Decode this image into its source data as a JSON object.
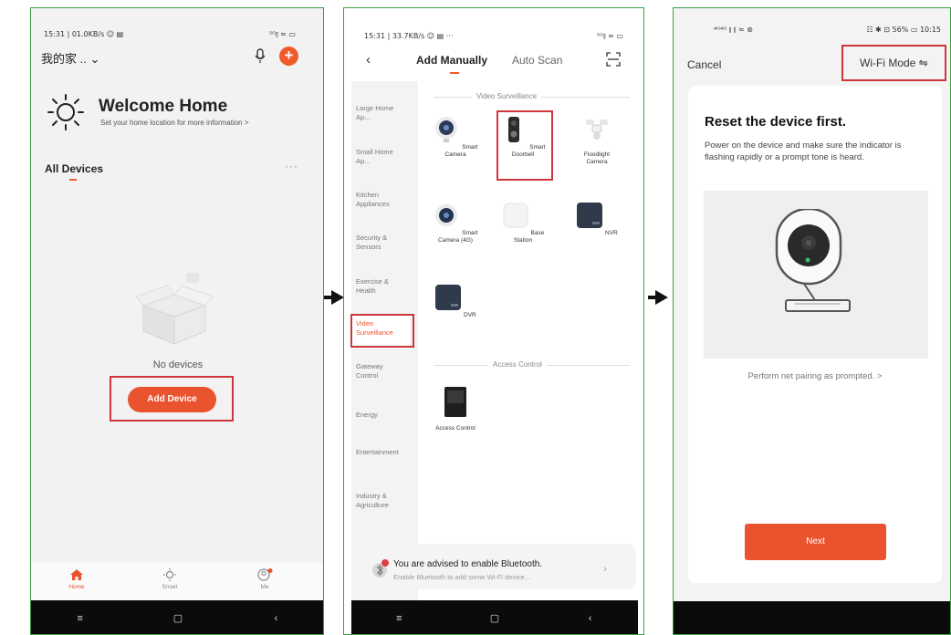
{
  "panel1": {
    "status_left": "15:31 | 01.0KB/s ☺ ▤",
    "status_right": "⁵ᴳ⫾ ≈ ▭",
    "home_title": "我的家 .. ⌄",
    "welcome_title": "Welcome Home",
    "welcome_sub": "Set your home location for more information >",
    "all_devices": "All Devices",
    "more": "···",
    "no_devices": "No devices",
    "add_device": "Add Device",
    "tabs": [
      "Home",
      "Smart",
      "Me"
    ],
    "nav": [
      "≡",
      "▢",
      "‹"
    ],
    "accent_color": "#e9542e"
  },
  "panel2": {
    "status_left": "15:31 | 33.7KB/s ☺ ▤ ···",
    "status_right": "⁵ᴳ⫾ ≈ ▭",
    "back": "‹",
    "tab_manual": "Add Manually",
    "tab_auto": "Auto Scan",
    "categories": [
      "Large Home Ap...",
      "Small Home Ap...",
      "Kitchen Appliances",
      "Security & Sensors",
      "Exercise & Health",
      "Video Surveillance",
      "Gateway Control",
      "Energy",
      "Entertainment",
      "Industry & Agriculture"
    ],
    "section_video": "Video Surveillance",
    "section_access": "Access Control",
    "items": [
      "Smart Camera",
      "Smart Doorbell",
      "Floodlight Camera",
      "Smart Camera (4G)",
      "Base Station",
      "NVR",
      "DVR",
      "Access Control"
    ],
    "bt_title": "You are advised to enable Bluetooth.",
    "bt_sub": "Enable Bluetooth to add some Wi-Fi device...",
    "nav": [
      "≡",
      "▢",
      "‹"
    ]
  },
  "panel3": {
    "status_left": "⁴ᴳ⁴ᴳ ⫾ ⫾ ≈ ⊛",
    "status_right": "☷ ✱ ⊡ 56% ▭ 10:15",
    "cancel": "Cancel",
    "wifi_mode": "Wi-Fi Mode ⇋",
    "reset_title": "Reset the device first.",
    "reset_desc": "Power on the device and make sure the indicator is flashing rapidly or a prompt tone is heard.",
    "pairing": "Perform net pairing as prompted. >",
    "next": "Next"
  }
}
